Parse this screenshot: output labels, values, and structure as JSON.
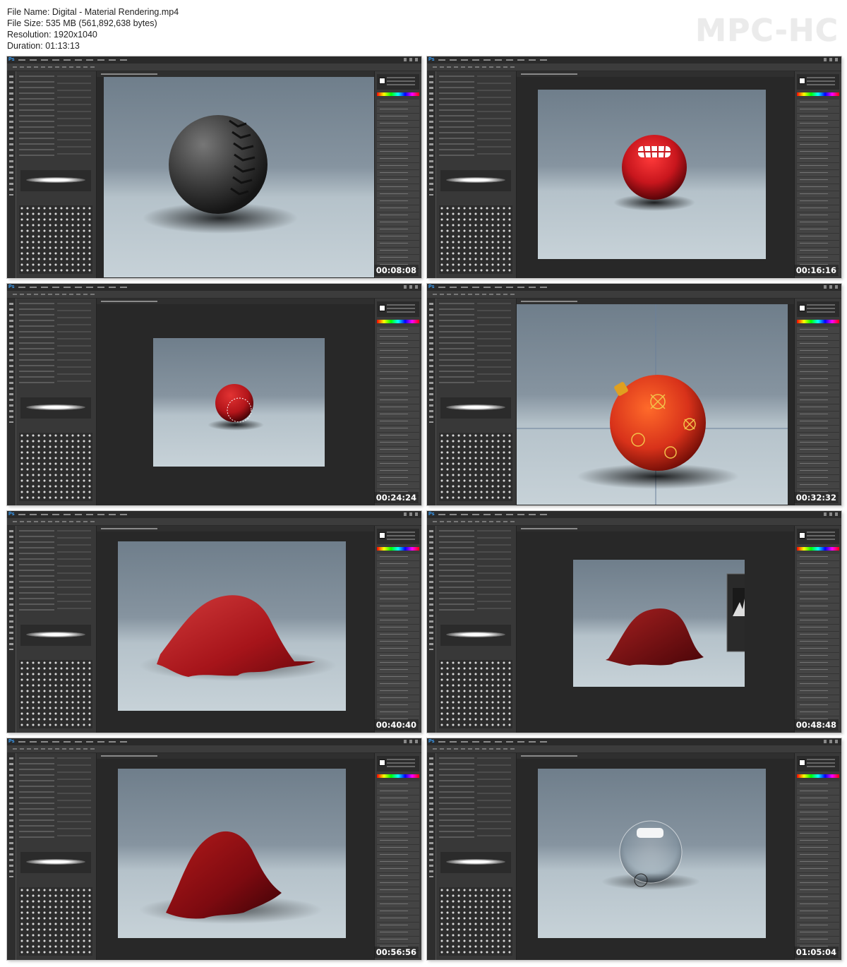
{
  "header": {
    "file_name": "File Name: Digital - Material Rendering.mp4",
    "file_size": "File Size: 535 MB (561,892,638 bytes)",
    "resolution": "Resolution: 1920x1040",
    "duration": "Duration: 01:13:13"
  },
  "brand": "MPC-HC",
  "app_logo": "Ps",
  "thumbnails": [
    {
      "timecode": "00:08:08",
      "subject": "rubber-ball-icon"
    },
    {
      "timecode": "00:16:16",
      "subject": "red-glossy-ball-icon"
    },
    {
      "timecode": "00:24:24",
      "subject": "red-ball-small-icon"
    },
    {
      "timecode": "00:32:32",
      "subject": "ornament-ball-icon"
    },
    {
      "timecode": "00:40:40",
      "subject": "red-cloth-icon"
    },
    {
      "timecode": "00:48:48",
      "subject": "red-cloth-levels-icon"
    },
    {
      "timecode": "00:56:56",
      "subject": "red-cloth-dark-icon"
    },
    {
      "timecode": "01:05:04",
      "subject": "glass-ball-icon"
    }
  ],
  "colors": {
    "canvas_top": "#6f7e8b",
    "canvas_bottom": "#c7d2d8",
    "ps_dark": "#282828",
    "red": "#c8161d"
  }
}
